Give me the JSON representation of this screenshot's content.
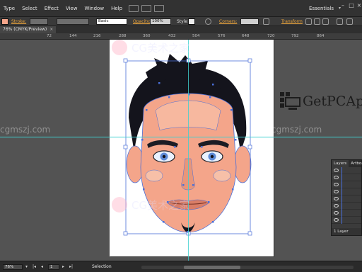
{
  "menu": {
    "items": [
      "Type",
      "Select",
      "Effect",
      "View",
      "Window",
      "Help"
    ],
    "workspace": "Essentials"
  },
  "control": {
    "stroke_label": "Stroke:",
    "brush_label": "Basic",
    "opacity_label": "Opacity:",
    "opacity_value": "100%",
    "style_label": "Style:",
    "corners_label": "Corners:",
    "transform_label": "Transform"
  },
  "document": {
    "tab_label": "76% (CMYK/Preview)",
    "close": "×"
  },
  "ruler": {
    "ticks": [
      "72",
      "144",
      "216",
      "288",
      "360",
      "432",
      "504",
      "576",
      "648",
      "720",
      "792",
      "864"
    ]
  },
  "watermarks": {
    "site_left": "cgmszj.com",
    "site_right": "cgmszj.com",
    "logo_text": "CG美术之家",
    "getpc": "GetPCAp"
  },
  "layers_panel": {
    "tab_layers": "Layers",
    "tab_artboards": "Artboa",
    "count": "1 Layer"
  },
  "status": {
    "zoom": "76%",
    "artboard_num": "1",
    "tool_state": "Selection"
  },
  "colors": {
    "skin": "#f4a58a",
    "hair": "#14141c",
    "selection": "#4a6fd8",
    "guide": "#3fd0d0",
    "accent_orange": "#e8a23a"
  }
}
